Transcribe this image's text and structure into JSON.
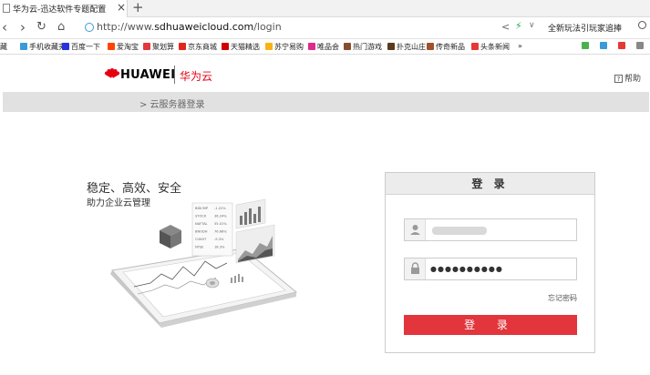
{
  "browser": {
    "tab_title": "华为云-迅达软件专题配置",
    "tab_close": "×",
    "new_tab": "+",
    "url_prefix": "http://www.",
    "url_domain": "sdhuaweicloud.com",
    "url_path": "/login",
    "news_text": "全新玩法引玩家追捧",
    "bookmarks": [
      {
        "label": "藏",
        "color": "#888888"
      },
      {
        "label": "手机收藏夹",
        "color": "#3a9bd8"
      },
      {
        "label": "百度一下",
        "color": "#2932e1"
      },
      {
        "label": "爱淘宝",
        "color": "#ff4400"
      },
      {
        "label": "聚划算",
        "color": "#e4393c"
      },
      {
        "label": "京东商城",
        "color": "#e1251b"
      },
      {
        "label": "天猫精选",
        "color": "#d00000"
      },
      {
        "label": "苏宁易购",
        "color": "#f9b216"
      },
      {
        "label": "唯品会",
        "color": "#e0298b"
      },
      {
        "label": "热门游戏",
        "color": "#8a4d2c"
      },
      {
        "label": "扑克山庄",
        "color": "#5a3b1c"
      },
      {
        "label": "传奇新品",
        "color": "#a0522d"
      },
      {
        "label": "头条新闻",
        "color": "#e53935"
      },
      {
        "label": "»",
        "color": "#ffffff"
      }
    ]
  },
  "header": {
    "brand": "HUAWEI",
    "product": "华为云",
    "help": "帮助",
    "brand_color": "#e60012"
  },
  "breadcrumb": "> 云服务器登录",
  "hero": {
    "slogan": "稳定、高效、安全",
    "subtitle": "助力企业云管理",
    "stocks": [
      "BIDCMP",
      "STOCK",
      "NAFTAL",
      "BNODH",
      "CUKHT",
      "NYSE"
    ],
    "percents": [
      "-1.22%",
      "36.24%",
      "55.01%",
      "76.66%",
      "-9.3%",
      "18.3%"
    ]
  },
  "login": {
    "title": "登 录",
    "username_placeholder": "",
    "password_value": "●●●●●●●●●●",
    "forgot": "忘记密码",
    "submit": "登 录",
    "accent": "#e2353c"
  }
}
